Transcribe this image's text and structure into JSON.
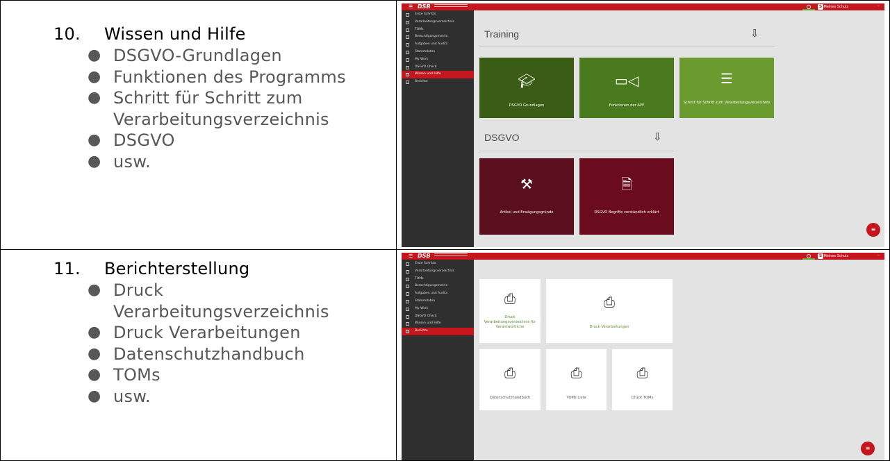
{
  "rows": [
    {
      "number": "10.",
      "title": "Wissen und Hilfe",
      "bullets": [
        "DSGVO-Grundlagen",
        "Funktionen des Programms",
        "Schritt für Schritt zum",
        "Verarbeitungsverzeichnis",
        "DSGVO",
        "usw."
      ]
    },
    {
      "number": "11.",
      "title": "Berichterstellung",
      "bullets": [
        "Druck",
        "Verarbeitungsverzeichnis",
        "Druck Verarbeitungen",
        "Datenschutzhandbuch",
        "TOMs",
        "usw."
      ]
    }
  ],
  "app": {
    "logo": "DSB",
    "user": "Melnes Schulz",
    "sidebar": [
      "Erste Schritte",
      "Verarbeitungsverzeichnis",
      "TOMs",
      "Berechtigungsmatrix",
      "Aufgaben und Audits",
      "Stammdaten",
      "My Work",
      "DSGVO Check",
      "Wissen und Hilfe",
      "Berichte"
    ],
    "colors": {
      "brand_red": "#c6161d",
      "sidebar_bg": "#2f2f2f"
    }
  },
  "screen1": {
    "training_title": "Training",
    "training_tiles": [
      {
        "label": "DSGVO Grundlagen",
        "icon": "graduation-cap-icon"
      },
      {
        "label": "Funktionen der APP",
        "icon": "video-camera-icon"
      },
      {
        "label": "Schritt für Schritt zum Verarbeitungsverzeichnis",
        "icon": "list-icon"
      }
    ],
    "dsgvo_title": "DSGVO",
    "dsgvo_tiles": [
      {
        "label": "Artikel und Erwägungsgründe",
        "icon": "gavel-icon"
      },
      {
        "label": "DSGVO Begriffe verständlich erklärt",
        "icon": "document-icon"
      }
    ]
  },
  "screen2": {
    "tiles": [
      {
        "label": "Druck Verarbeitungsverzeichnis für Verantwortliche",
        "icon": "printer-icon"
      },
      {
        "label": "Druck Verarbeitungen",
        "icon": "printer-icon"
      },
      {
        "label": "Datenschutzhandbuch",
        "icon": "printer-icon"
      },
      {
        "label": "TOMs Liste",
        "icon": "printer-icon"
      },
      {
        "label": "Druck TOMs",
        "icon": "printer-icon"
      }
    ]
  }
}
